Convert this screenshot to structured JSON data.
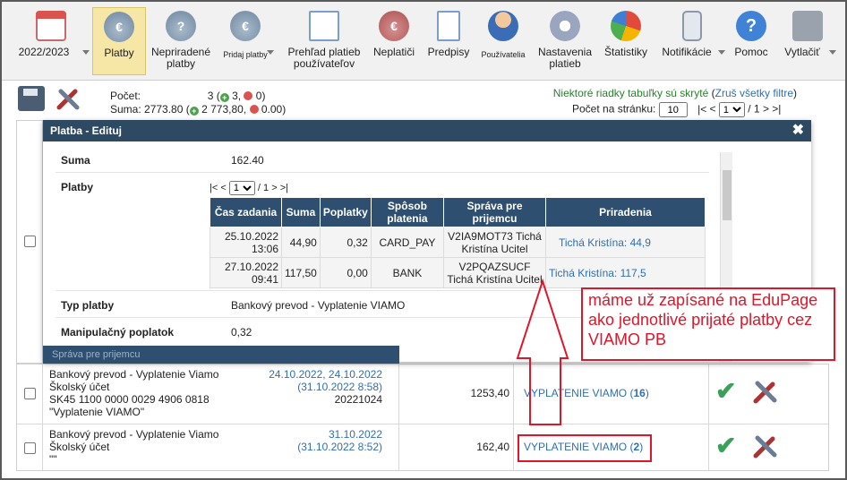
{
  "toolbar": {
    "items": [
      {
        "label": "2022/2023",
        "icon": "calendar-icon"
      },
      {
        "label": "Platby",
        "icon": "money-bag-icon",
        "active": true
      },
      {
        "label": "Nepriradené platby",
        "icon": "money-bag-question-icon"
      },
      {
        "label": "Pridaj platby",
        "icon": "money-bag-add-icon"
      },
      {
        "label": "Prehľad platieb používateľov",
        "icon": "ledger-icon"
      },
      {
        "label": "Neplatiči",
        "icon": "money-bag-overdue-icon"
      },
      {
        "label": "Predpisy",
        "icon": "document-icon"
      },
      {
        "label": "Používatelia",
        "icon": "user-icon"
      },
      {
        "label": "Nastavenia platieb",
        "icon": "gear-icon"
      },
      {
        "label": "Štatistiky",
        "icon": "pie-chart-icon"
      },
      {
        "label": "Notifikácie",
        "icon": "phone-icon"
      },
      {
        "label": "Pomoc",
        "icon": "help-icon"
      },
      {
        "label": "Vytlačiť",
        "icon": "printer-icon"
      }
    ]
  },
  "summary": {
    "count_label": "Počet:",
    "count_value": "3",
    "count_plus": "3,",
    "count_minus": "0)",
    "sum_label": "Suma:",
    "sum_value": "2773.80",
    "sum_plus": "2 773,80,",
    "sum_minus": "0.00)"
  },
  "filter_notice": {
    "text": "Niektoré riadky tabuľky sú skryté",
    "link": "Zruš všetky filtre"
  },
  "pager": {
    "per_page_label": "Počet na stránku:",
    "per_page_value": "10",
    "first": "|<",
    "prev": "<",
    "page": "1",
    "of": "/ 1",
    "next": ">",
    "last": ">|"
  },
  "dialog": {
    "title": "Platba - Edituj",
    "fields": {
      "suma_label": "Suma",
      "suma_value": "162.40",
      "platby_label": "Platby",
      "typ_label": "Typ platby",
      "typ_value": "Bankový prevod - Vyplatenie VIAMO",
      "poplatok_label": "Manipulačný poplatok",
      "poplatok_value": "0,32"
    },
    "pager": {
      "first": "|<",
      "prev": "<",
      "page": "1",
      "of": "/ 1",
      "next": ">",
      "last": ">|"
    },
    "table": {
      "headers": [
        "Čas zadania",
        "Suma",
        "Poplatky",
        "Spôsob platenia",
        "Správa pre prijemcu",
        "Priradenia"
      ],
      "rows": [
        {
          "cas": "25.10.2022 13:06",
          "suma": "44,90",
          "poplatky": "0,32",
          "sposob": "CARD_PAY",
          "sprava": "V2IA9MOT73 Tichá Kristína Ucitel",
          "priradenie": "Tichá Kristína: 44,9"
        },
        {
          "cas": "27.10.2022 09:41",
          "suma": "117,50",
          "poplatky": "0,00",
          "sposob": "BANK",
          "sprava": "V2PQAZSUCF Tichá Kristína Ucitel",
          "priradenie": "Tichá Kristína: 117,5"
        }
      ]
    },
    "partial_button": "Správa pre prijemcu"
  },
  "annotation": {
    "text": "máme už zapísané na EduPage ako jednotlivé prijaté platby cez VIAMO PB",
    "color": "#e0152a"
  },
  "rows": [
    {
      "desc1": "Bankový prevod - Vyplatenie Viamo",
      "desc2": "Školský účet",
      "desc3": "SK45 1100 0000 0029 4906 0818",
      "desc4": "\"Vyplatenie VIAMO\"",
      "date1": "24.10.2022, 24.10.2022",
      "date2": "(31.10.2022 8:58)",
      "ref": "20221024",
      "amount": "1253,40",
      "assign": "VYPLATENIE VIAMO",
      "assign_count": "16"
    },
    {
      "desc1": "Bankový prevod - Vyplatenie Viamo",
      "desc2": "Školský účet",
      "desc3": "\"\"",
      "date1": "31.10.2022",
      "date2": "(31.10.2022 8:52)",
      "amount": "162,40",
      "assign": "VYPLATENIE VIAMO",
      "assign_count": "2"
    }
  ]
}
